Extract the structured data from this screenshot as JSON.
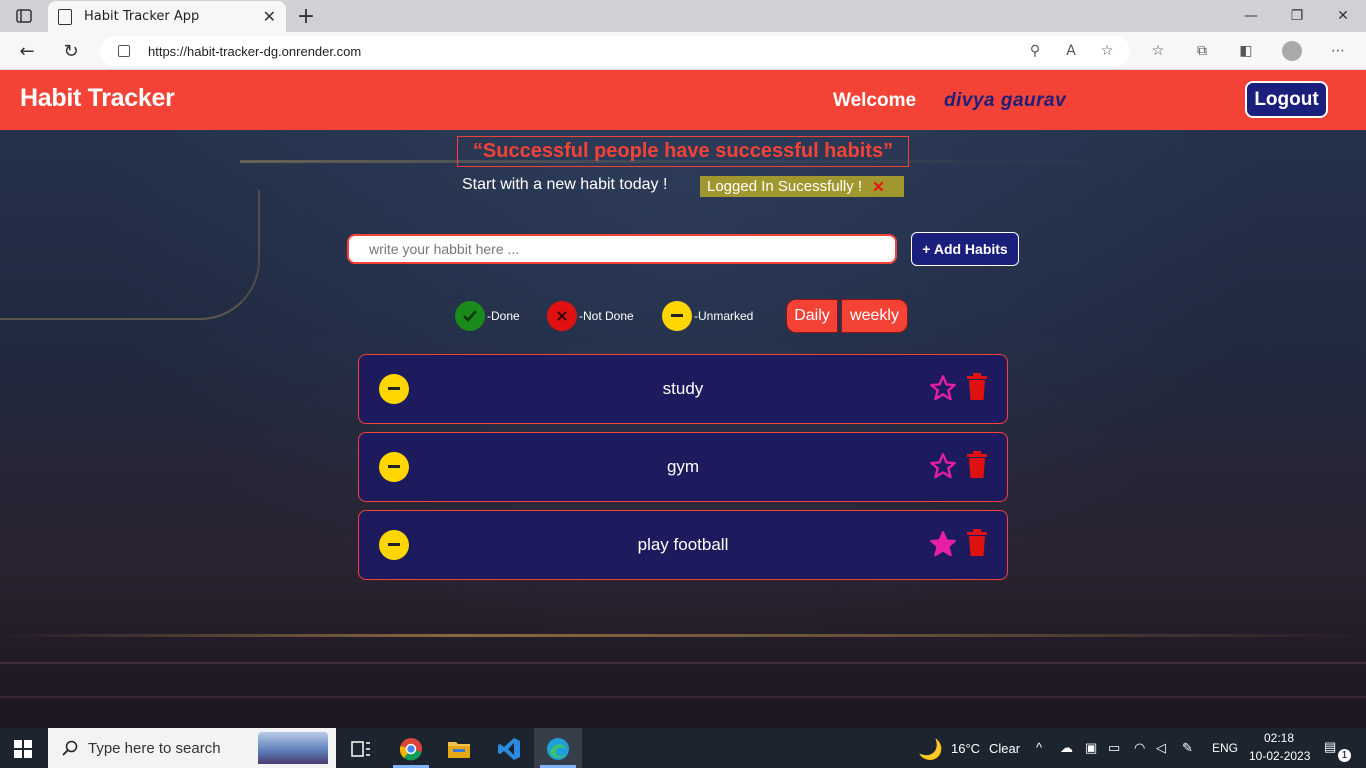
{
  "browser": {
    "tab_title": "Habit Tracker App",
    "url": "https://habit-tracker-dg.onrender.com"
  },
  "header": {
    "brand": "Habit Tracker",
    "welcome": "Welcome",
    "username": "divya gaurav",
    "logout_label": "Logout"
  },
  "quote": "“Successful people have successful habits”",
  "subline": "Start with a new habit today !",
  "alert": {
    "message": "Logged In Sucessfully !",
    "close": "✕"
  },
  "add_habit": {
    "placeholder": "write your habbit here ...",
    "button_label": "+ Add Habits"
  },
  "legend": {
    "done": "-Done",
    "not_done": "-Not Done",
    "unmarked": "-Unmarked"
  },
  "view_toggle": {
    "daily": "Daily",
    "weekly": "weekly"
  },
  "habits": [
    {
      "name": "study",
      "status": "unmarked",
      "favorite": false
    },
    {
      "name": "gym",
      "status": "unmarked",
      "favorite": false
    },
    {
      "name": "play football",
      "status": "unmarked",
      "favorite": true
    }
  ],
  "colors": {
    "accent": "#f44336",
    "navy": "#1b1f7c",
    "card": "#1e1a5e",
    "done": "#1a8a1a",
    "not_done": "#e01111",
    "unmarked": "#ffd600",
    "star": "#e61ea8",
    "trash": "#e01111"
  },
  "taskbar": {
    "search_placeholder": "Type here to search",
    "weather_temp": "16°C",
    "weather_text": "Clear",
    "language": "ENG",
    "time": "02:18",
    "date": "10-02-2023",
    "notifications": "1"
  }
}
